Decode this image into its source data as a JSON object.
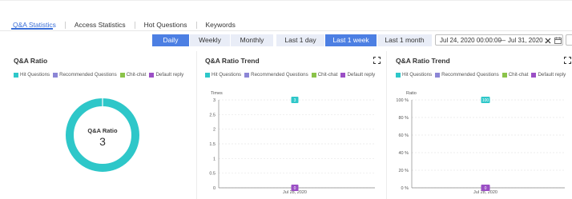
{
  "tabs": [
    {
      "label": "Q&A Statistics",
      "active": true
    },
    {
      "label": "Access Statistics",
      "active": false
    },
    {
      "label": "Hot Questions",
      "active": false
    },
    {
      "label": "Keywords",
      "active": false
    }
  ],
  "granularity": [
    {
      "label": "Daily",
      "active": true
    },
    {
      "label": "Weekly",
      "active": false
    },
    {
      "label": "Monthly",
      "active": false
    }
  ],
  "periods": [
    {
      "label": "Last 1 day",
      "active": false
    },
    {
      "label": "Last 1 week",
      "active": true
    },
    {
      "label": "Last 1 month",
      "active": false
    }
  ],
  "date_range": {
    "start": "Jul 24, 2020 00:00:00",
    "separator": "—",
    "end": "Jul 31, 2020 ..."
  },
  "legend": [
    {
      "label": "Hit Questions",
      "color": "#2ec7c9"
    },
    {
      "label": "Recommended Questions",
      "color": "#8c86d6"
    },
    {
      "label": "Chit-chat",
      "color": "#8bc34a"
    },
    {
      "label": "Default reply",
      "color": "#9b4fc5"
    }
  ],
  "colors": {
    "accent": "#3b6fd8",
    "segment_active": "#4c7fe3",
    "segment_idle": "#e9edf7"
  },
  "panels": {
    "ratio": {
      "title": "Q&A Ratio",
      "center_label": "Q&A Ratio",
      "center_value": "3"
    },
    "trend": {
      "title": "Q&A Ratio Trend"
    },
    "trend_percent": {
      "title": "Q&A Ratio Trend"
    }
  },
  "chart_data": [
    {
      "type": "pie",
      "title": "Q&A Ratio",
      "labels": [
        "Hit Questions",
        "Recommended Questions",
        "Chit-chat",
        "Default reply"
      ],
      "values": [
        3,
        0,
        0,
        0
      ],
      "center_label": "Q&A Ratio",
      "center_value": "3",
      "legend": "top-left"
    },
    {
      "type": "bar",
      "title": "Q&A Ratio Trend",
      "ylabel": "Times",
      "categories": [
        "Jul 28, 2020"
      ],
      "series": [
        {
          "name": "Hit Questions",
          "values": [
            3
          ]
        },
        {
          "name": "Default reply",
          "values": [
            0
          ]
        }
      ],
      "ylim": [
        0,
        3
      ],
      "yticks": [
        "0",
        "0.5",
        "1",
        "1.5",
        "2",
        "2.5",
        "3"
      ],
      "grid": true,
      "legend": "top-left"
    },
    {
      "type": "bar",
      "title": "Q&A Ratio Trend",
      "ylabel": "Ratio",
      "categories": [
        "Jul 28, 2020"
      ],
      "series": [
        {
          "name": "Hit Questions",
          "values": [
            100
          ]
        },
        {
          "name": "Default reply",
          "values": [
            0
          ]
        }
      ],
      "ylim": [
        0,
        100
      ],
      "yticks": [
        "0 %",
        "20 %",
        "40 %",
        "60 %",
        "80 %",
        "100 %"
      ],
      "grid": true,
      "legend": "top-left"
    }
  ]
}
